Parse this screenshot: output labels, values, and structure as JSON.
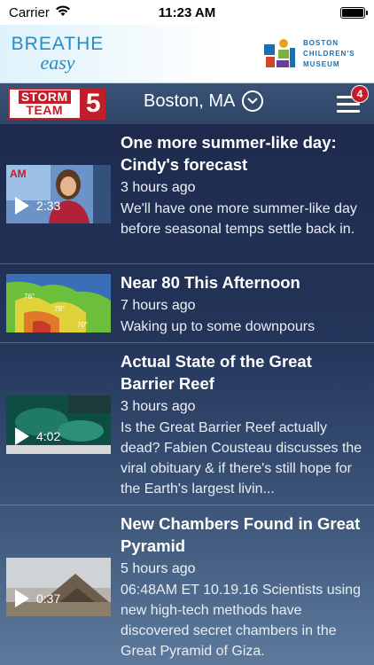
{
  "status_bar": {
    "carrier": "Carrier",
    "time": "11:23 AM"
  },
  "ad": {
    "line1": "BREATHE",
    "line2": "easy",
    "sponsor": "BOSTON CHILDREN'S MUSEUM"
  },
  "header": {
    "brand_top": "STORM",
    "brand_bottom": "TEAM",
    "brand_number": "5",
    "location": "Boston, MA",
    "menu_badge": "4"
  },
  "feed": [
    {
      "title": "One more summer-like day: Cindy's forecast",
      "time": "3 hours ago",
      "description": "We'll have one more summer-like day before seasonal temps settle back in.",
      "duration": "2:33"
    },
    {
      "title": "Near 80 This Afternoon",
      "time": "7 hours ago",
      "description": "Waking up to some downpours",
      "duration": ""
    },
    {
      "title": "Actual State of the Great Barrier Reef",
      "time": "3 hours ago",
      "description": "Is the Great Barrier Reef actually dead? Fabien Cousteau discusses the viral obituary & if there's still hope for the Earth's largest livin...",
      "duration": "4:02"
    },
    {
      "title": "New Chambers Found in Great Pyramid",
      "time": "5 hours ago",
      "description": "06:48AM ET 10.19.16 Scientists using new high-tech methods have discovered secret chambers in the Great Pyramid of Giza.",
      "duration": "0:37"
    }
  ]
}
